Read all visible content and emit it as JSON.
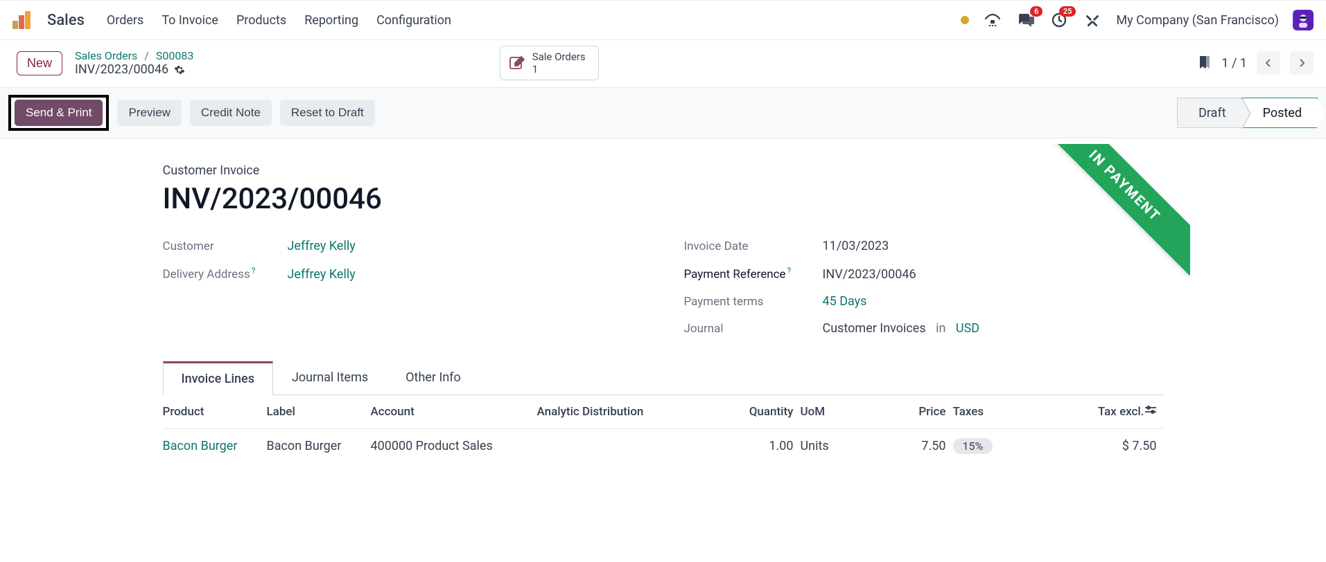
{
  "app": {
    "title": "Sales"
  },
  "nav": {
    "orders": "Orders",
    "to_invoice": "To Invoice",
    "products": "Products",
    "reporting": "Reporting",
    "configuration": "Configuration"
  },
  "systray": {
    "messages_badge": "6",
    "activities_badge": "25",
    "company": "My Company (San Francisco)"
  },
  "controlpanel": {
    "new_btn": "New",
    "breadcrumb": {
      "root": "Sales Orders",
      "parent": "S00083",
      "current": "INV/2023/00046"
    },
    "smart_button": {
      "title": "Sale Orders",
      "count": "1"
    },
    "pager": "1 / 1"
  },
  "statusbar": {
    "send_print": "Send & Print",
    "preview": "Preview",
    "credit_note": "Credit Note",
    "reset_draft": "Reset to Draft",
    "draft": "Draft",
    "posted": "Posted"
  },
  "ribbon": "IN PAYMENT",
  "sheet": {
    "label": "Customer Invoice",
    "title": "INV/2023/00046",
    "customer_label": "Customer",
    "customer_value": "Jeffrey Kelly",
    "delivery_label": "Delivery Address",
    "delivery_value": "Jeffrey Kelly",
    "invoice_date_label": "Invoice Date",
    "invoice_date_value": "11/03/2023",
    "payment_ref_label": "Payment Reference",
    "payment_ref_value": "INV/2023/00046",
    "payment_terms_label": "Payment terms",
    "payment_terms_value": "45 Days",
    "journal_label": "Journal",
    "journal_value": "Customer Invoices",
    "journal_in": "in",
    "journal_currency": "USD"
  },
  "tabs": {
    "invoice_lines": "Invoice Lines",
    "journal_items": "Journal Items",
    "other_info": "Other Info"
  },
  "table": {
    "headers": {
      "product": "Product",
      "label": "Label",
      "account": "Account",
      "analytic": "Analytic Distribution",
      "quantity": "Quantity",
      "uom": "UoM",
      "price": "Price",
      "taxes": "Taxes",
      "tax_excl": "Tax excl."
    },
    "rows": [
      {
        "product": "Bacon Burger",
        "label": "Bacon Burger",
        "account": "400000 Product Sales",
        "analytic": "",
        "quantity": "1.00",
        "uom": "Units",
        "price": "7.50",
        "taxes": "15%",
        "tax_excl": "$ 7.50"
      }
    ]
  }
}
